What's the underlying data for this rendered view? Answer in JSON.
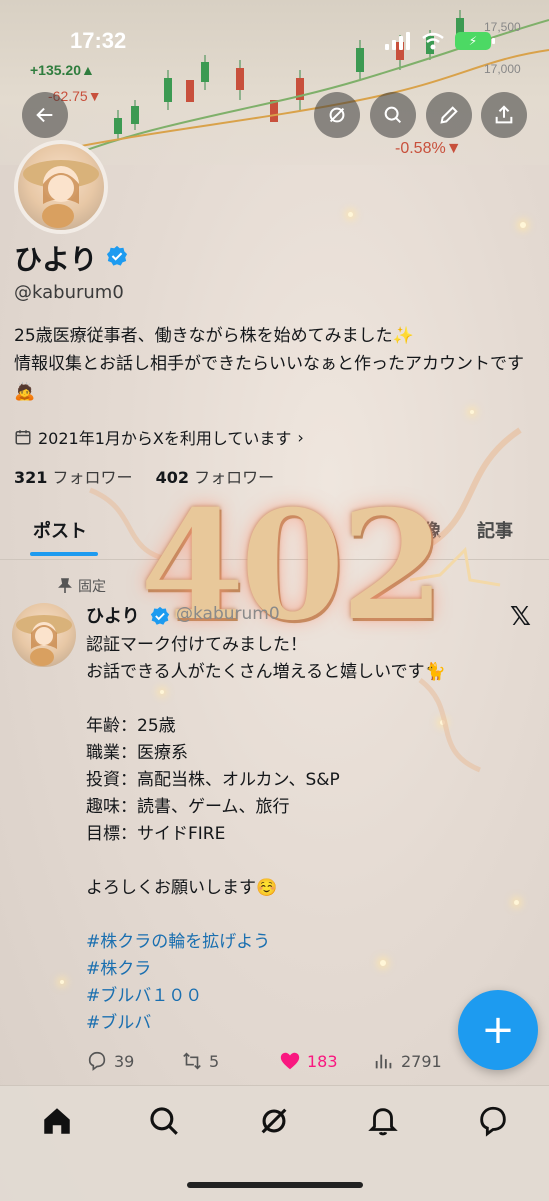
{
  "status_bar": {
    "time": "17:32",
    "battery": "⚡"
  },
  "banner": {
    "ticker_up": "+135.20▲",
    "ticker_down_left": "-62.75▼",
    "ticker_down_right": "-0.58%▼",
    "price_1": "17,500",
    "price_2": "17,000"
  },
  "profile": {
    "display_name": "ひより",
    "handle": "@kaburum0",
    "bio_line1": "25歳医療従事者、働きながら株を始めてみました✨",
    "bio_line2": "情報収集とお話し相手ができたらいいなぁと作ったアカウントです🙇",
    "joined": "2021年1月からXを利用しています",
    "following_count": "321",
    "following_label": "フォロワー",
    "followers_count": "402",
    "followers_label": "フォロワー"
  },
  "tabs": [
    {
      "label": "ポスト",
      "active": true
    },
    {
      "label": "画像",
      "active": false
    },
    {
      "label": "記事",
      "active": false
    }
  ],
  "overlay_number": "402",
  "pinned_post": {
    "pinned_label": "固定",
    "author": "ひより",
    "handle": "@kaburum0",
    "lines": [
      "認証マーク付けてみました！",
      "お話できる人がたくさん増えると嬉しいです🐈",
      "",
      "年齢：25歳",
      "職業：医療系",
      "投資：高配当株、オルカン、S&P",
      "趣味：読書、ゲーム、旅行",
      "目標：サイドFIRE",
      "",
      "よろしくお願いします☺️",
      ""
    ],
    "hashtags": [
      "#株クラの輪を拡げよう",
      "#株クラ",
      "#ブルバ１００",
      "#ブルバ"
    ],
    "replies": "39",
    "reposts": "5",
    "likes": "183",
    "views": "2791"
  },
  "colors": {
    "accent": "#1d9bf0",
    "like": "#f91880",
    "background": "#e4dad2"
  }
}
